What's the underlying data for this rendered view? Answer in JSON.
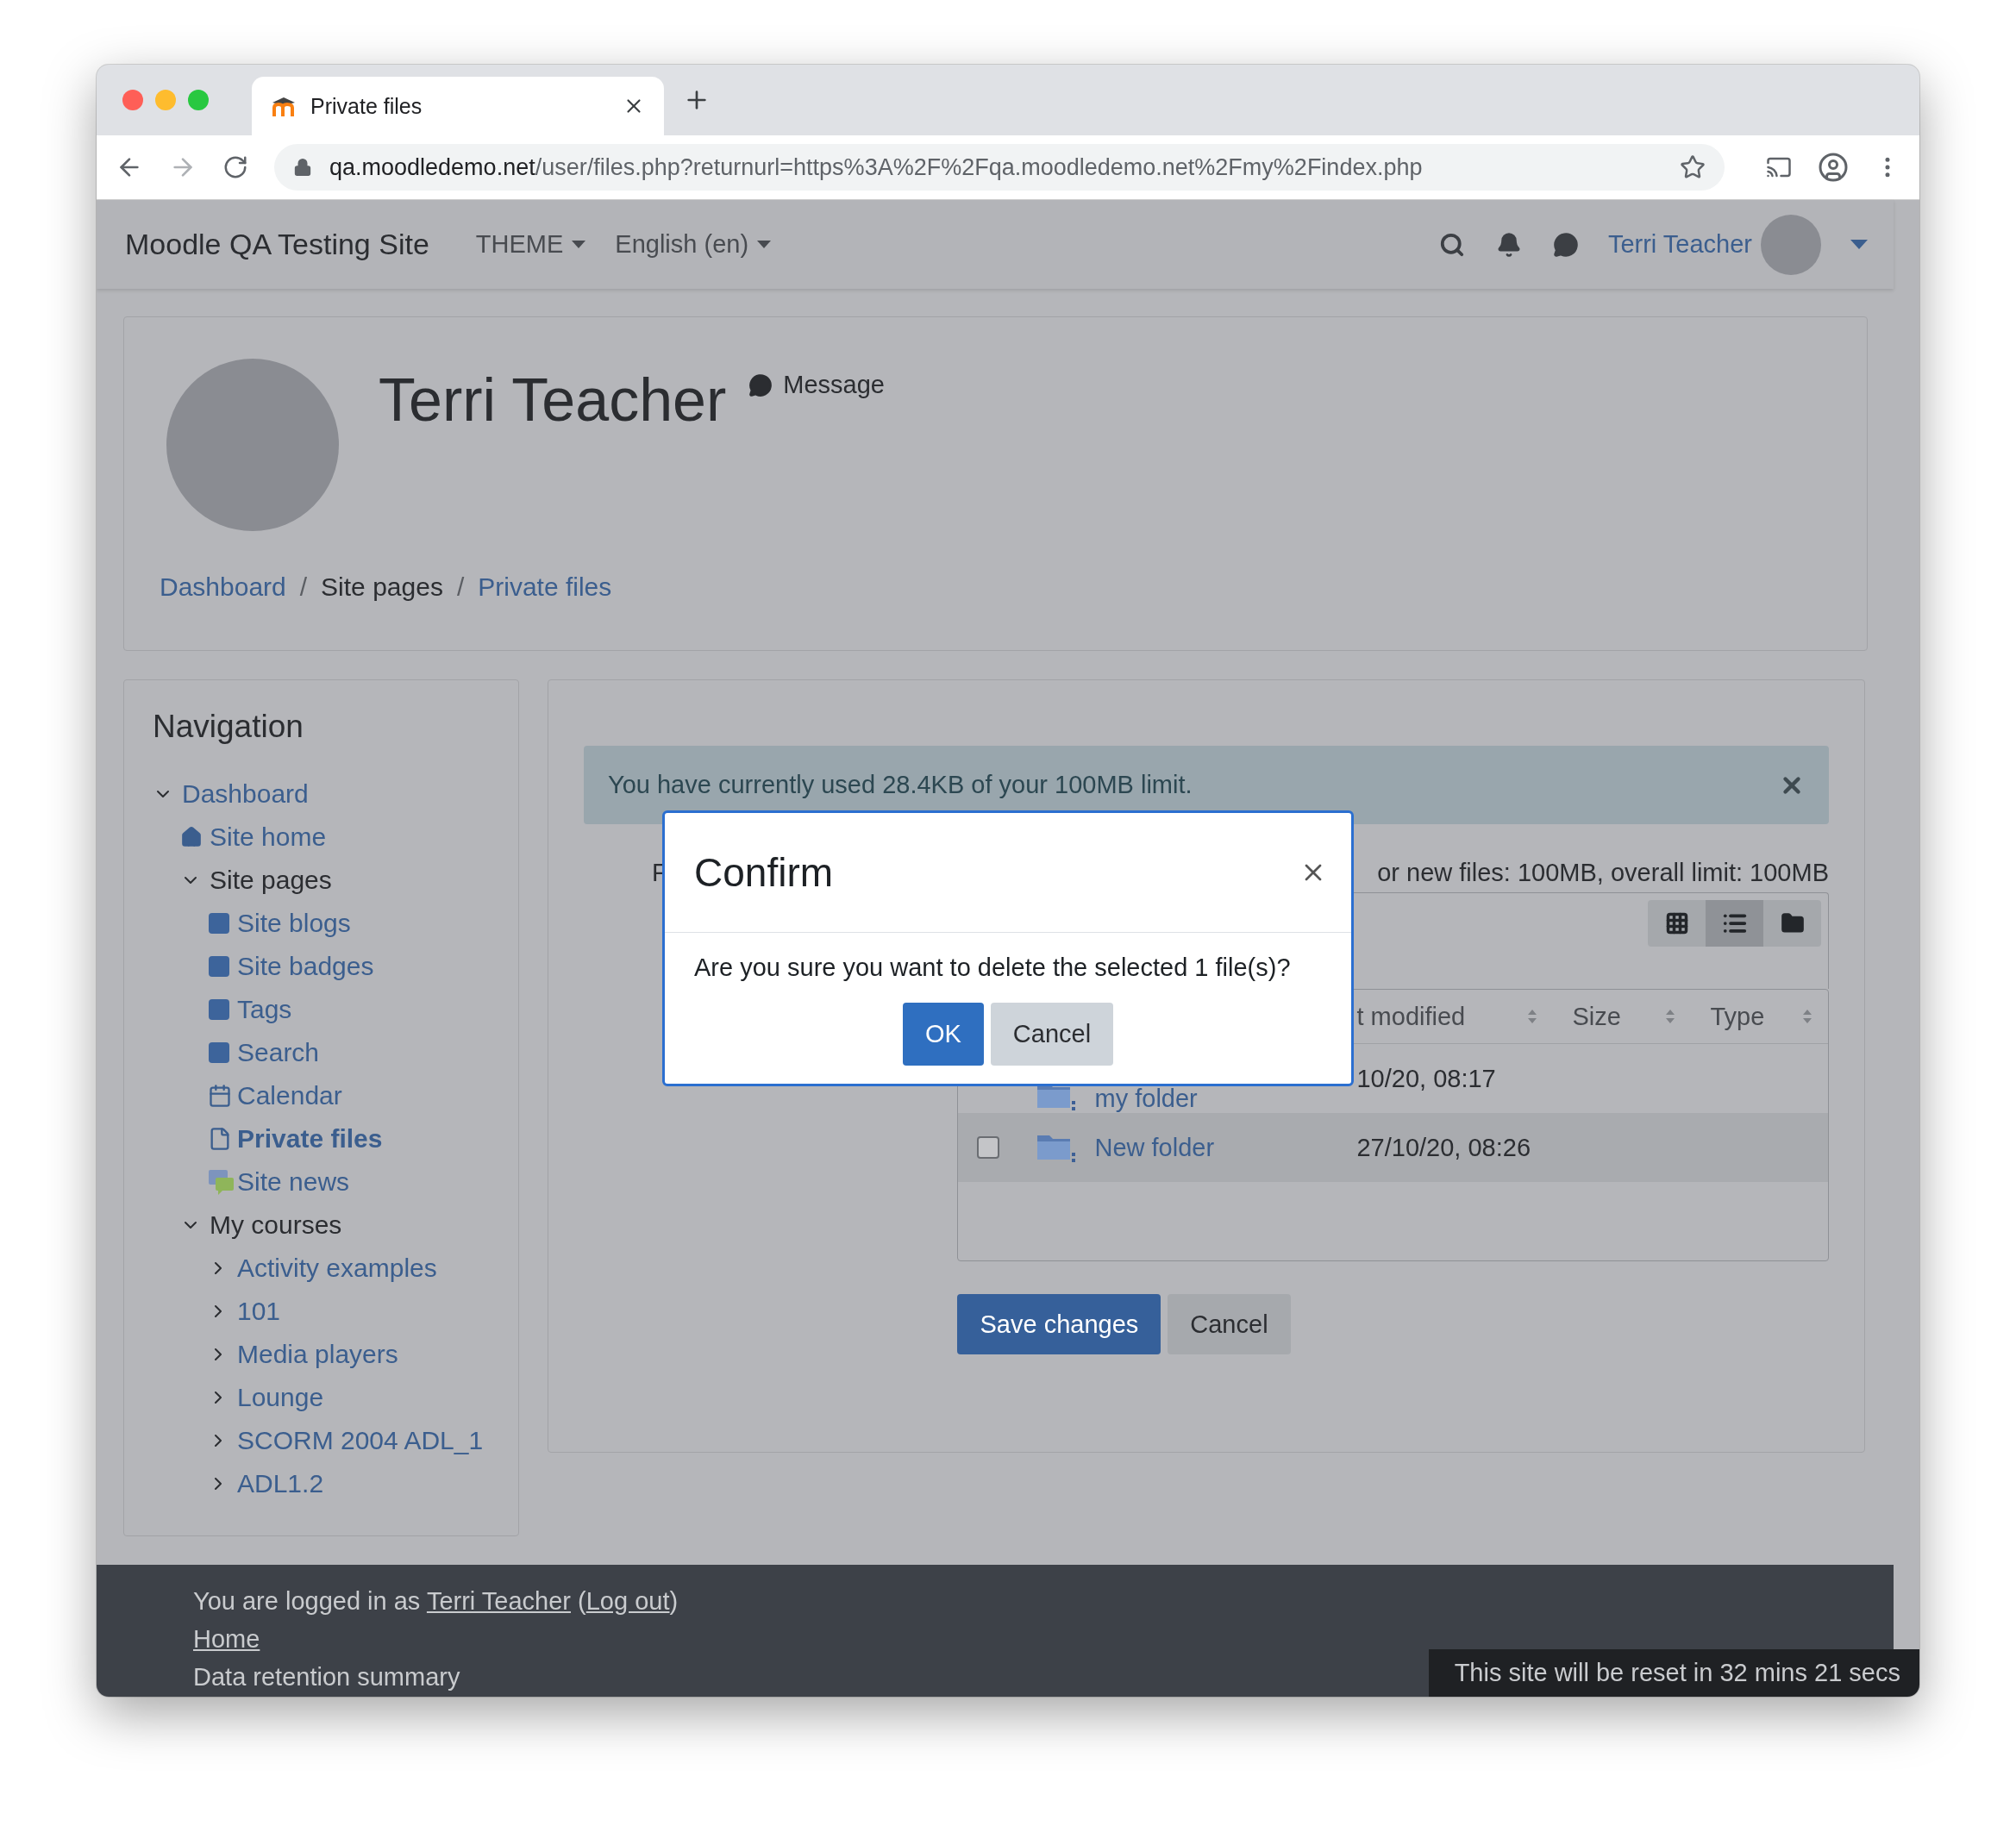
{
  "browser": {
    "tab": {
      "title": "Private files",
      "selected": true
    },
    "url": {
      "host": "qa.moodledemo.net",
      "path": "/user/files.php?returnurl=https%3A%2F%2Fqa.moodledemo.net%2Fmy%2Findex.php"
    }
  },
  "navbar": {
    "site_name": "Moodle QA Testing Site",
    "menus": [
      "THEME",
      "English (en)"
    ],
    "user_name": "Terri Teacher"
  },
  "profile": {
    "name": "Terri Teacher",
    "message_label": "Message",
    "breadcrumb_separator": "/",
    "breadcrumb": [
      {
        "label": "Dashboard",
        "link": true
      },
      {
        "label": "Site pages",
        "link": false
      },
      {
        "label": "Private files",
        "link": true
      }
    ]
  },
  "navigation": {
    "title": "Navigation",
    "items": [
      {
        "label": "Dashboard",
        "kind": "branch",
        "expanded": true,
        "link": true,
        "selected": false,
        "children": [
          {
            "label": "Site home",
            "kind": "home",
            "link": true,
            "selected": false
          },
          {
            "label": "Site pages",
            "kind": "branch",
            "expanded": true,
            "link": false,
            "selected": false,
            "children": [
              {
                "label": "Site blogs",
                "kind": "page",
                "link": true,
                "selected": false
              },
              {
                "label": "Site badges",
                "kind": "page",
                "link": true,
                "selected": false
              },
              {
                "label": "Tags",
                "kind": "page",
                "link": true,
                "selected": false
              },
              {
                "label": "Search",
                "kind": "page",
                "link": true,
                "selected": false
              },
              {
                "label": "Calendar",
                "kind": "calendar",
                "link": true,
                "selected": false
              },
              {
                "label": "Private files",
                "kind": "file",
                "link": true,
                "selected": true
              },
              {
                "label": "Site news",
                "kind": "news",
                "link": true,
                "selected": false
              }
            ]
          },
          {
            "label": "My courses",
            "kind": "branch",
            "expanded": true,
            "link": false,
            "selected": false,
            "children": [
              {
                "label": "Activity examples",
                "kind": "branch",
                "expanded": false,
                "link": true,
                "selected": false
              },
              {
                "label": "101",
                "kind": "branch",
                "expanded": false,
                "link": true,
                "selected": false
              },
              {
                "label": "Media players",
                "kind": "branch",
                "expanded": false,
                "link": true,
                "selected": false
              },
              {
                "label": "Lounge",
                "kind": "branch",
                "expanded": false,
                "link": true,
                "selected": false
              },
              {
                "label": "SCORM 2004 ADL_1",
                "kind": "branch",
                "expanded": false,
                "link": true,
                "selected": false
              },
              {
                "label": "ADL1.2",
                "kind": "branch",
                "expanded": false,
                "link": true,
                "selected": false
              }
            ]
          }
        ]
      }
    ]
  },
  "files": {
    "alert": "You have currently used 28.4KB of your 100MB limit.",
    "label": "F",
    "limits": "or new files: 100MB, overall limit: 100MB",
    "views": [
      {
        "kind": "grid",
        "selected": false
      },
      {
        "kind": "list",
        "selected": true
      },
      {
        "kind": "tree",
        "selected": false
      }
    ],
    "columns": [
      "t modified",
      "Size",
      "Type"
    ],
    "rows": [
      {
        "name": "my folder",
        "modified": "10/20, 08:17",
        "highlighted": false
      },
      {
        "name": "New folder",
        "modified": "27/10/20, 08:26",
        "highlighted": true,
        "checked": false
      }
    ],
    "buttons": [
      {
        "label": "Save changes",
        "kind": "primary"
      },
      {
        "label": "Cancel",
        "kind": "secondary"
      }
    ]
  },
  "dialog": {
    "title": "Confirm",
    "message": "Are you sure you want to delete the selected 1 file(s)?",
    "buttons": [
      {
        "label": "OK",
        "kind": "primary"
      },
      {
        "label": "Cancel",
        "kind": "secondary"
      }
    ]
  },
  "footer": {
    "login_prefix": "You are logged in as ",
    "user_link": "Terri Teacher",
    "open_paren": " (",
    "logout_link": "Log out",
    "close_paren": ")",
    "links": [
      "Home",
      "Data retention summary"
    ],
    "reset_notice": "This site will be reset in 32 mins 21 secs"
  }
}
